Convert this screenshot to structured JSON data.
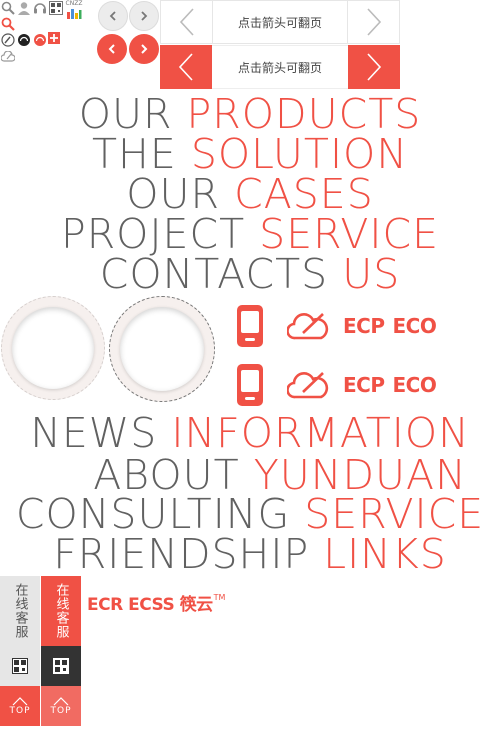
{
  "pager": {
    "light_label": "点击箭头可翻页",
    "red_label": "点击箭头可翻页"
  },
  "top_icons": {
    "qr_caption": "CNZZ"
  },
  "headlines": [
    {
      "w1": "OUR",
      "w2": "PRODUCTS"
    },
    {
      "w1": "THE",
      "w2": "SOLUTION"
    },
    {
      "w1": "OUR",
      "w2": "CASES"
    },
    {
      "w1": "PROJECT",
      "w2": "SERVICE"
    },
    {
      "w1": "CONTACTS",
      "w2": "US"
    }
  ],
  "headlines2": [
    {
      "w1": "NEWS",
      "w2": "INFORMATION"
    },
    {
      "w1": "ABOUT",
      "w2": "YUNDUAN"
    },
    {
      "w1": "CONSULTING",
      "w2": "SERVICE"
    },
    {
      "w1": "FRIENDSHIP",
      "w2": "LINKS"
    }
  ],
  "logos": {
    "ecp": "ECP",
    "eco": "ECO",
    "brand": "ECR ECSS 筷云",
    "brand_tm": "TM"
  },
  "sidebar": {
    "service_grey": "在线客服",
    "service_red": "在线客服",
    "top_grey": "TOP",
    "top_red": "TOP"
  },
  "colors": {
    "accent": "#f05145",
    "text_grey": "#616161",
    "light_bg": "#ececec"
  }
}
